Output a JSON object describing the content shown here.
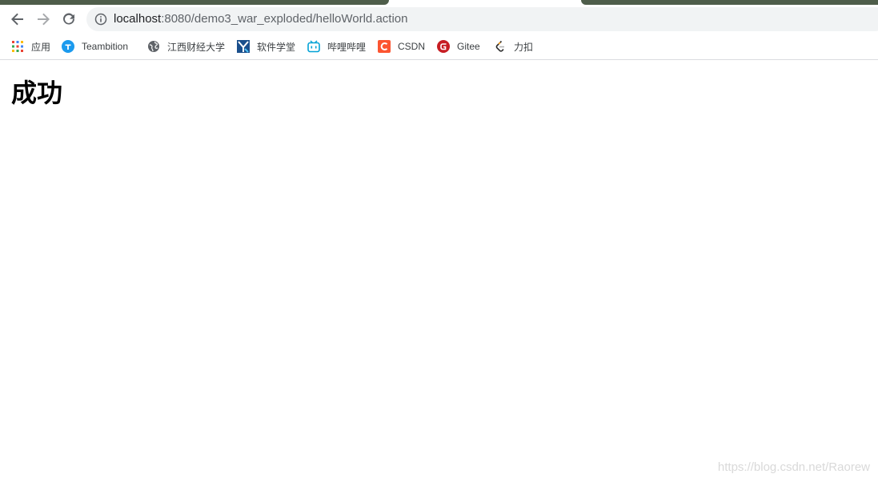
{
  "browser": {
    "address_bar": {
      "host": "localhost",
      "path": ":8080/demo3_war_exploded/helloWorld.action"
    },
    "nav": {
      "back_icon": "arrow-left-icon",
      "forward_icon": "arrow-right-icon",
      "reload_icon": "reload-icon",
      "info_icon": "info-icon"
    },
    "bookmarks": [
      {
        "label": "应用",
        "icon": "apps-grid-icon"
      },
      {
        "label": "Teambition",
        "icon": "teambition-icon"
      },
      {
        "label": "江西财经大学",
        "icon": "globe-icon"
      },
      {
        "label": "软件学堂",
        "icon": "software-school-icon"
      },
      {
        "label": "哔哩哔哩",
        "icon": "bilibili-icon"
      },
      {
        "label": "CSDN",
        "icon": "csdn-icon"
      },
      {
        "label": "Gitee",
        "icon": "gitee-icon"
      },
      {
        "label": "力扣",
        "icon": "leetcode-icon"
      }
    ]
  },
  "page": {
    "heading": "成功",
    "watermark": "https://blog.csdn.net/Raorew"
  },
  "colors": {
    "tab_strip": "#4e5d4a",
    "omnibox_bg": "#f1f3f4",
    "teambition": "#1b9aee",
    "bilibili": "#00a1d6",
    "csdn": "#fc5531",
    "gitee": "#c71d23"
  }
}
